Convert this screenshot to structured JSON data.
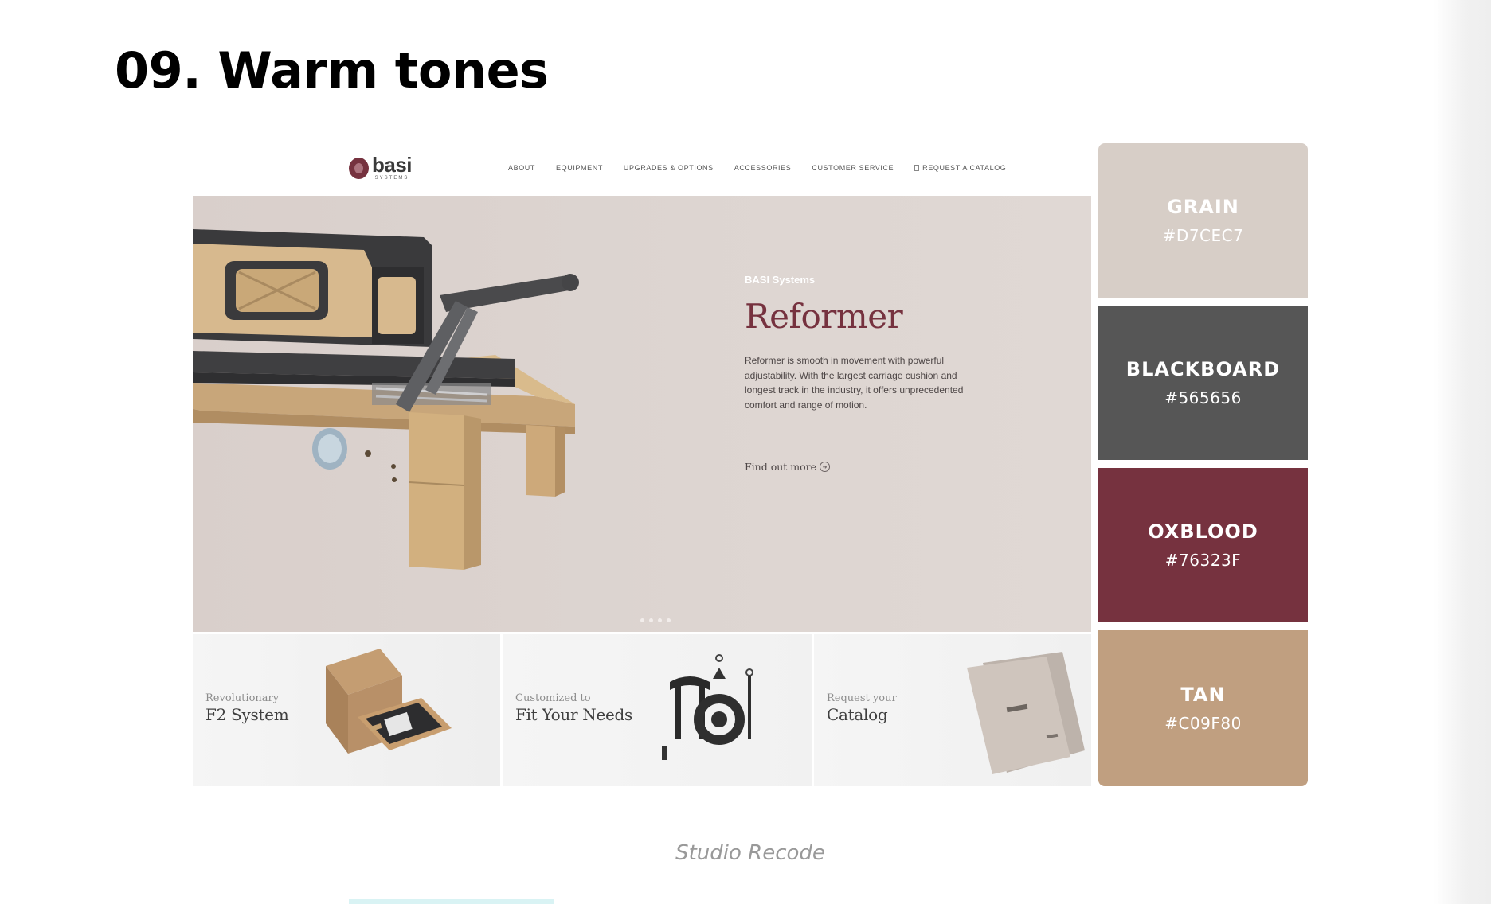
{
  "page": {
    "title": "09. Warm tones",
    "caption": "Studio Recode"
  },
  "site": {
    "logo": {
      "word": "basi",
      "sub": "SYSTEMS"
    },
    "nav": [
      "ABOUT",
      "EQUIPMENT",
      "UPGRADES & OPTIONS",
      "ACCESSORIES",
      "CUSTOMER SERVICE",
      "REQUEST A CATALOG"
    ],
    "hero": {
      "eyebrow": "BASI Systems",
      "title": "Reformer",
      "text": "Reformer is smooth in movement with powerful adjustability. With the largest carriage cushion and longest track in the industry, it offers unprecedented comfort and range of motion.",
      "link": "Find out more",
      "slide_count": 4
    },
    "tiles": [
      {
        "small": "Revolutionary",
        "big": "F2 System"
      },
      {
        "small": "Customized to",
        "big": "Fit Your Needs"
      },
      {
        "small": "Request your",
        "big": "Catalog"
      }
    ]
  },
  "palette": [
    {
      "name": "GRAIN",
      "hex": "#D7CEC7",
      "color": "#d7cec7"
    },
    {
      "name": "BLACKBOARD",
      "hex": "#565656",
      "color": "#565656"
    },
    {
      "name": "OXBLOOD",
      "hex": "#76323F",
      "color": "#76323f"
    },
    {
      "name": "TAN",
      "hex": "#C09F80",
      "color": "#c09f80"
    }
  ]
}
